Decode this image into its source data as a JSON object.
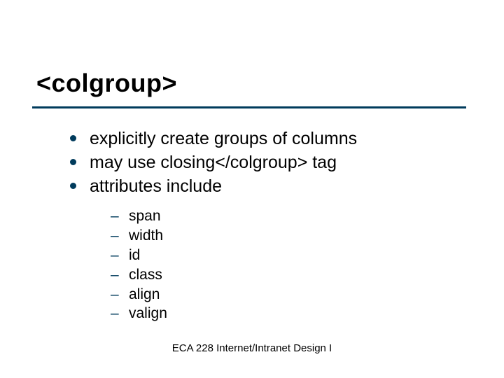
{
  "title": "<colgroup>",
  "bullets": {
    "b0": "explicitly create groups of columns",
    "b1": "may use closing</colgroup> tag",
    "b2": "attributes include"
  },
  "subbullets": {
    "s0": "span",
    "s1": "width",
    "s2": "id",
    "s3": "class",
    "s4": "align",
    "s5": "valign"
  },
  "footer": "ECA 228  Internet/Intranet Design I"
}
